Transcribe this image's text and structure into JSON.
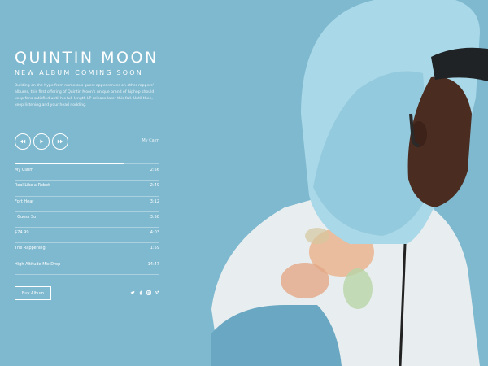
{
  "artist": {
    "name": "QUINTIN MOON",
    "subtitle": "NEW ALBUM COMING SOON",
    "description": "Building on the hype from numerous guest appearances on other rappers' albums, this first offering of Quintin Moon's unique brand of hiphop should keep fans satisfied until his full-length LP release later this fall. Until then, keep listening and your head nodding."
  },
  "player": {
    "now_playing": "My Calm",
    "progress": 0.75,
    "buttons": [
      "rewind-icon",
      "play-icon",
      "fast-forward-icon"
    ]
  },
  "tracks": [
    {
      "name": "My Claim",
      "duration": "2:56"
    },
    {
      "name": "Real Like a Robot",
      "duration": "2:49"
    },
    {
      "name": "Fort Hear",
      "duration": "3:12"
    },
    {
      "name": "I Guess So",
      "duration": "3:58"
    },
    {
      "name": "$74.99",
      "duration": "4:03"
    },
    {
      "name": "The Rappening",
      "duration": "1:59"
    },
    {
      "name": "High Altitude Mic Drop",
      "duration": "14:47"
    }
  ],
  "cta": {
    "buy_label": "Buy Album"
  },
  "socials": [
    "twitter-icon",
    "facebook-icon",
    "instagram-icon",
    "vimeo-icon"
  ],
  "colors": {
    "background": "#7fb9cf",
    "text": "#ffffff",
    "hood": "#a9d8e8",
    "skin": "#4a2c20"
  }
}
